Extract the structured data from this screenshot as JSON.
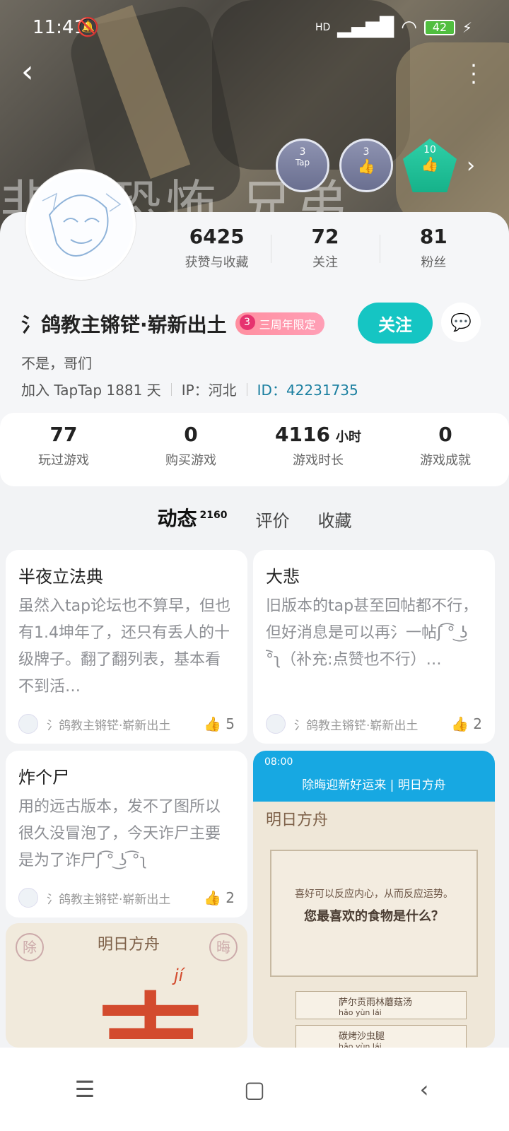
{
  "status": {
    "time": "11:41",
    "battery": "42",
    "net": "HD"
  },
  "banner": {
    "overlay_text": "非常恐怖 兄弟"
  },
  "badges": [
    {
      "count": "3",
      "label": "Tap"
    },
    {
      "count": "3",
      "label": ""
    },
    {
      "count": "10",
      "label": ""
    }
  ],
  "profile": {
    "stats": [
      {
        "value": "6425",
        "label": "获赞与收藏"
      },
      {
        "value": "72",
        "label": "关注"
      },
      {
        "value": "81",
        "label": "粉丝"
      }
    ],
    "name": "氵鸽教主锵铓·崭新出土",
    "limit_tag": "三周年限定",
    "follow_label": "关注",
    "bio": "不是，哥们",
    "join": "加入 TapTap 1881 天",
    "ip": "IP：河北",
    "id": "ID：42231735"
  },
  "game_stats": [
    {
      "value": "77",
      "unit": "",
      "label": "玩过游戏"
    },
    {
      "value": "0",
      "unit": "",
      "label": "购买游戏"
    },
    {
      "value": "4116",
      "unit": "小时",
      "label": "游戏时长"
    },
    {
      "value": "0",
      "unit": "",
      "label": "游戏成就"
    }
  ],
  "tabs": [
    {
      "label": "动态",
      "count": "2160"
    },
    {
      "label": "评价"
    },
    {
      "label": "收藏"
    }
  ],
  "posts": [
    {
      "title": "半夜立法典",
      "body": "虽然入tap论坛也不算早，但也有1.4坤年了，还只有丢人的十级牌子。翻了翻列表，基本看不到活…",
      "author": "氵鸽教主锵铓·崭新出土",
      "likes": "5"
    },
    {
      "title": "大悲",
      "body": "旧版本的tap甚至回帖都不行，但好消息是可以再氵一帖ʃ ͡° ͜ʖ ͡°ʅ（补充:点赞也不行）…",
      "author": "氵鸽教主锵铓·崭新出土",
      "likes": "2"
    },
    {
      "title": "炸个尸",
      "body": "用的远古版本，发不了图所以很久没冒泡了，今天诈尸主要是为了诈尸ʃ ͡° ͜ʖ ͡°ʅ",
      "author": "氵鸽教主锵铓·崭新出土",
      "likes": "2"
    }
  ],
  "image_post": {
    "time": "08:00",
    "title": "除晦迎新好运来 | 明日方舟",
    "brand": "明日方舟",
    "question_sub": "喜好可以反应内心，从而反应运势。",
    "question": "您最喜欢的食物是什么？",
    "options": [
      {
        "name": "萨尔贡雨林蘑菇汤",
        "pinyin": "hǎo yùn lái"
      },
      {
        "name": "碳烤沙虫腿",
        "pinyin": "hǎo yùn lái"
      }
    ]
  },
  "image_post2": {
    "brand": "明日方舟",
    "char": "吉",
    "pinyin": "jí",
    "left_char": "除",
    "right_char": "晦"
  }
}
